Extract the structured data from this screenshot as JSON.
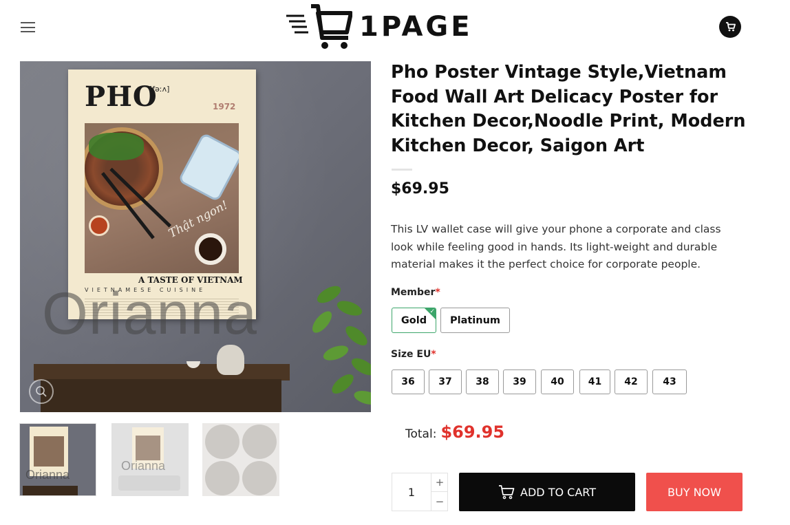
{
  "header": {
    "logo_text": "1PAGE",
    "menu_icon": "hamburger-menu-icon",
    "cart_icon": "shopping-cart-icon"
  },
  "gallery": {
    "main_image": {
      "poster_title": "PHO",
      "poster_phonetic": "[fəːʌ]",
      "poster_year": "1972",
      "poster_script": "Thật ngon!",
      "poster_tagline": "A TASTE OF VIETNAM",
      "poster_subtitle": "VIETNAMESE CUISINE",
      "watermark": "Orianna"
    },
    "zoom_icon": "zoom-in-icon",
    "thumbnails": [
      {
        "alt": "Pho poster on gray wall",
        "watermark": "Orianna"
      },
      {
        "alt": "Pho poster in living room",
        "watermark": "Orianna"
      },
      {
        "alt": "Poster material details"
      }
    ]
  },
  "product": {
    "title": "Pho Poster Vintage Style,Vietnam Food Wall Art Delicacy Poster for Kitchen Decor,Noodle Print, Modern Kitchen Decor, Saigon Art",
    "price": "$69.95",
    "description": "This LV wallet case will give your phone a corporate and class look while feeling good in hands. Its light-weight and durable material makes it the perfect choice for corporate people."
  },
  "options": {
    "member_label": "Member",
    "required_mark": "*",
    "member_options": [
      "Gold",
      "Platinum"
    ],
    "member_selected": "Gold",
    "size_label": "Size EU",
    "sizes": [
      "36",
      "37",
      "38",
      "39",
      "40",
      "41",
      "42",
      "43"
    ]
  },
  "total": {
    "label": "Total:",
    "value": "$69.95"
  },
  "actions": {
    "quantity": "1",
    "plus": "+",
    "minus": "−",
    "add_to_cart": "ADD TO CART",
    "buy_now": "BUY NOW"
  },
  "colors": {
    "accent_red": "#e0322c",
    "buy_button": "#f0504c",
    "cart_button": "#0b0b0b",
    "selected_green": "#3ca56a"
  }
}
